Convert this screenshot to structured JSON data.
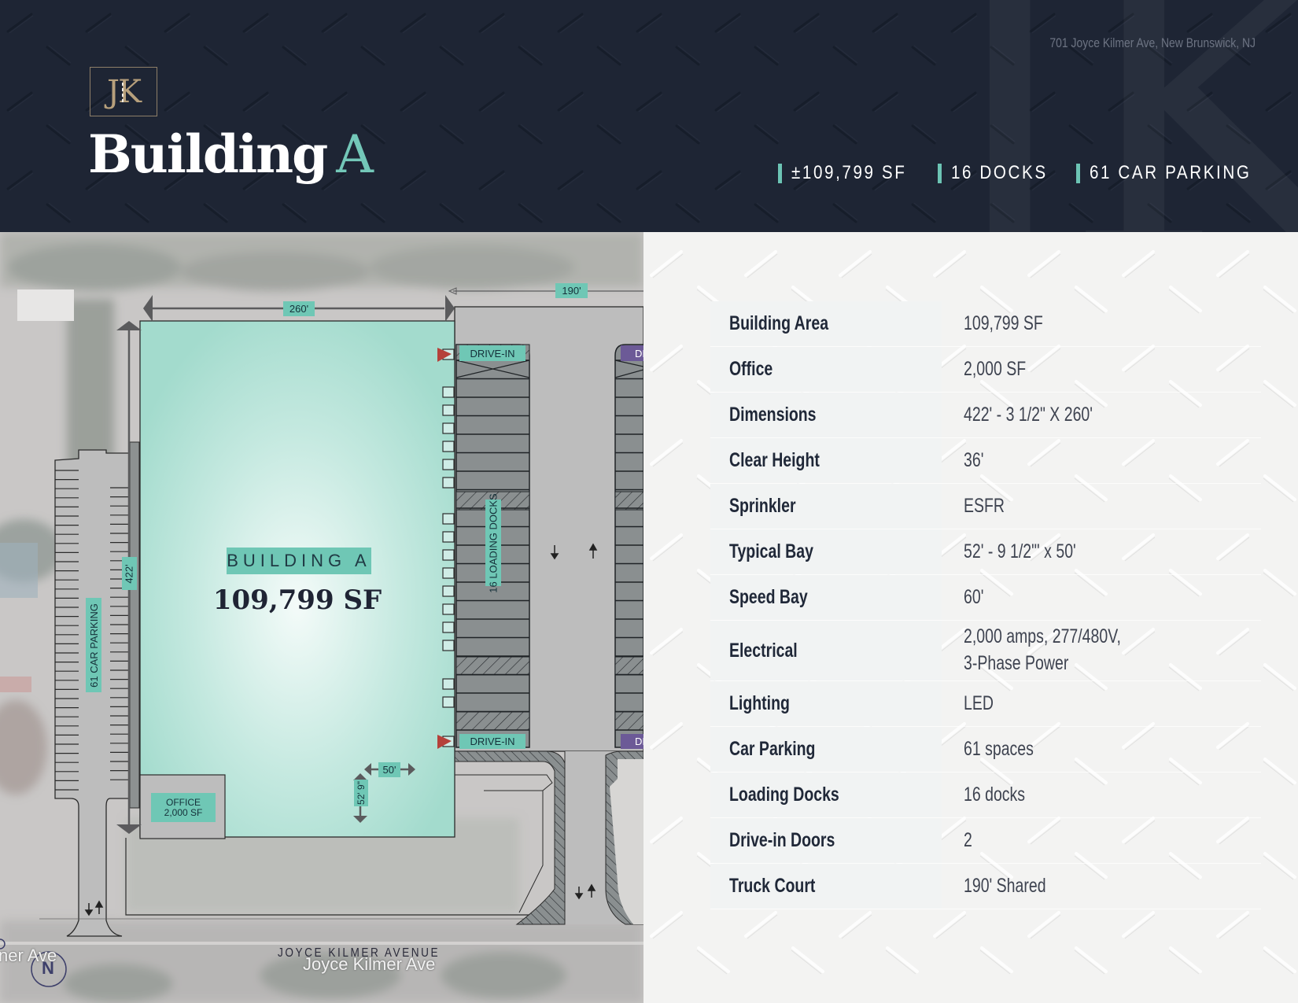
{
  "header": {
    "logo": "JK",
    "title_main": "Building",
    "title_accent": "A",
    "address": "701 Joyce Kilmer Ave, New Brunswick, NJ",
    "stats": [
      {
        "label": "±109,799 SF"
      },
      {
        "label": "16 DOCKS"
      },
      {
        "label": "61 CAR PARKING"
      }
    ]
  },
  "site_plan": {
    "dim_width": "260'",
    "dim_truck_court": "190'",
    "dim_length": "422'",
    "building_label": "BUILDING A",
    "building_area": "109,799 SF",
    "office_label_line1": "OFFICE",
    "office_label_line2": "2,000 SF",
    "bay_width": "50'",
    "bay_depth": "52' 9\"",
    "loading_docks_label": "16 LOADING DOCKS",
    "drive_in_top": "DRIVE-IN",
    "drive_in_bottom": "DRIVE-IN",
    "neighbor_drive_in": "DI",
    "parking_label": "61 CAR PARKING",
    "street_label": "JOYCE KILMER AVENUE",
    "map_street_label": "Joyce Kilmer Ave",
    "map_street_label_left": "ner Ave",
    "north_label": "N",
    "colors": {
      "building": "#a7dccf",
      "label_bg": "#6fc7b5",
      "drive_in_marker": "#b5413a",
      "neighbor_label": "#6c5a97"
    }
  },
  "specs": [
    {
      "label": "Building Area",
      "value": "109,799 SF"
    },
    {
      "label": "Office",
      "value": "2,000 SF"
    },
    {
      "label": "Dimensions",
      "value": "422' - 3 1/2\" X 260'"
    },
    {
      "label": "Clear Height",
      "value": "36'"
    },
    {
      "label": "Sprinkler",
      "value": "ESFR"
    },
    {
      "label": "Typical Bay",
      "value": "52' - 9 1/2\"' x 50'"
    },
    {
      "label": "Speed Bay",
      "value": "60'"
    },
    {
      "label": "Electrical",
      "value": "2,000 amps, 277/480V,",
      "value2": "3-Phase Power"
    },
    {
      "label": "Lighting",
      "value": "LED"
    },
    {
      "label": "Car Parking",
      "value": "61 spaces"
    },
    {
      "label": "Loading Docks",
      "value": "16 docks"
    },
    {
      "label": "Drive-in Doors",
      "value": "2"
    },
    {
      "label": "Truck Court",
      "value": "190' Shared"
    }
  ]
}
